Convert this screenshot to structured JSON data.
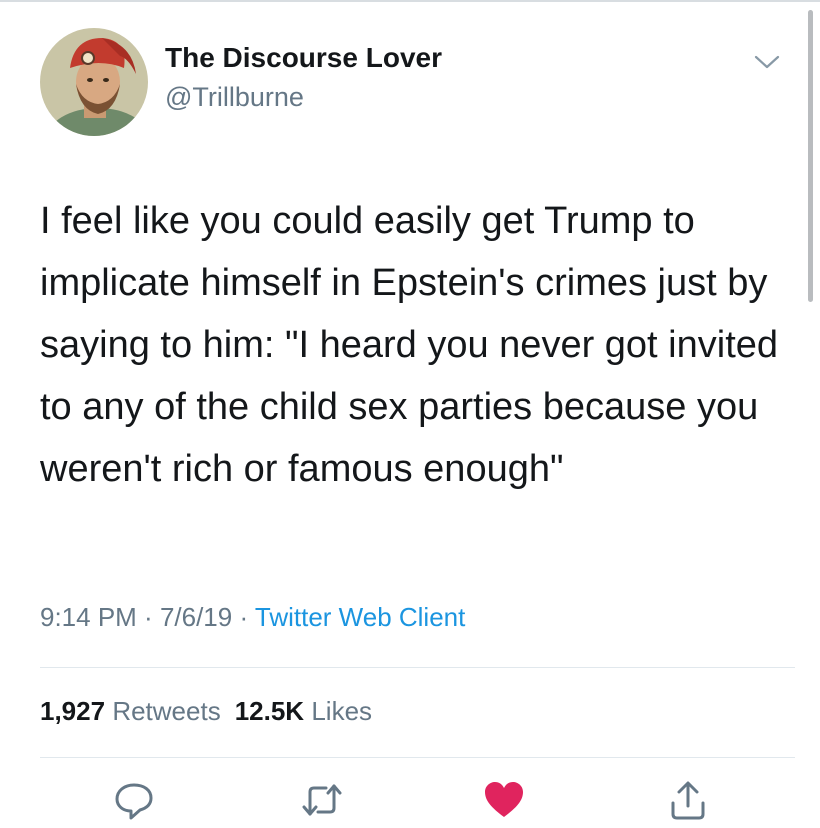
{
  "user": {
    "display_name": "The Discourse Lover",
    "handle": "@Trillburne",
    "avatar_icon": "red-hat-man-avatar"
  },
  "tweet": {
    "text": "I feel like you could easily get Trump to implicate himself in Epstein's crimes just by saying to him: \"I heard you never got invited to any of the child sex parties because you weren't rich or famous enough\""
  },
  "meta": {
    "time": "9:14 PM",
    "separator": " · ",
    "date": "7/6/19",
    "client": "Twitter Web Client"
  },
  "stats": {
    "retweets_count": "1,927",
    "retweets_label": "Retweets",
    "likes_count": "12.5K",
    "likes_label": "Likes"
  },
  "actions": [
    {
      "icon": "reply-icon"
    },
    {
      "icon": "retweet-icon"
    },
    {
      "icon": "like-icon",
      "color": "#e0245e"
    },
    {
      "icon": "share-icon"
    }
  ],
  "colors": {
    "text": "#14171a",
    "secondary": "#657786",
    "link": "#1b95e0",
    "like": "#e0245e"
  }
}
